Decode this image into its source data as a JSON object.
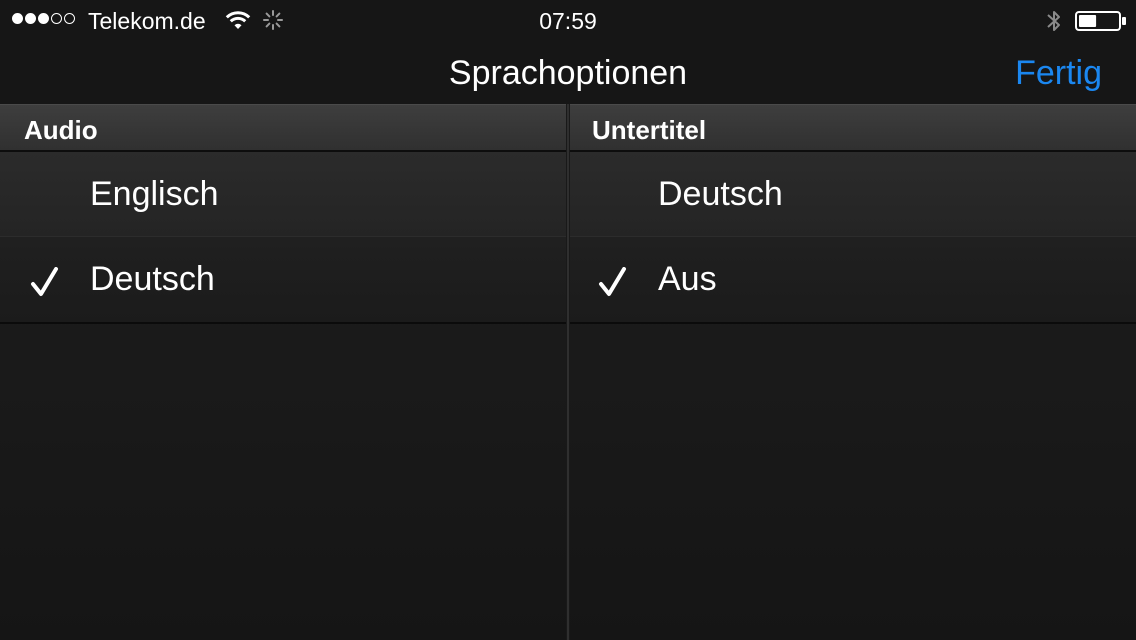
{
  "status_bar": {
    "carrier": "Telekom.de",
    "time": "07:59",
    "signal_strength": 3,
    "signal_max": 5,
    "battery_level": 0.45,
    "icons": [
      "wifi-icon",
      "activity-indicator-icon",
      "bluetooth-icon",
      "battery-icon"
    ]
  },
  "nav_bar": {
    "title": "Sprachoptionen",
    "done_label": "Fertig",
    "accent_color": "#1b87f0"
  },
  "audio": {
    "header": "Audio",
    "options": [
      {
        "label": "Englisch",
        "selected": false
      },
      {
        "label": "Deutsch",
        "selected": true
      }
    ]
  },
  "subtitles": {
    "header": "Untertitel",
    "options": [
      {
        "label": "Deutsch",
        "selected": false
      },
      {
        "label": "Aus",
        "selected": true
      }
    ]
  }
}
